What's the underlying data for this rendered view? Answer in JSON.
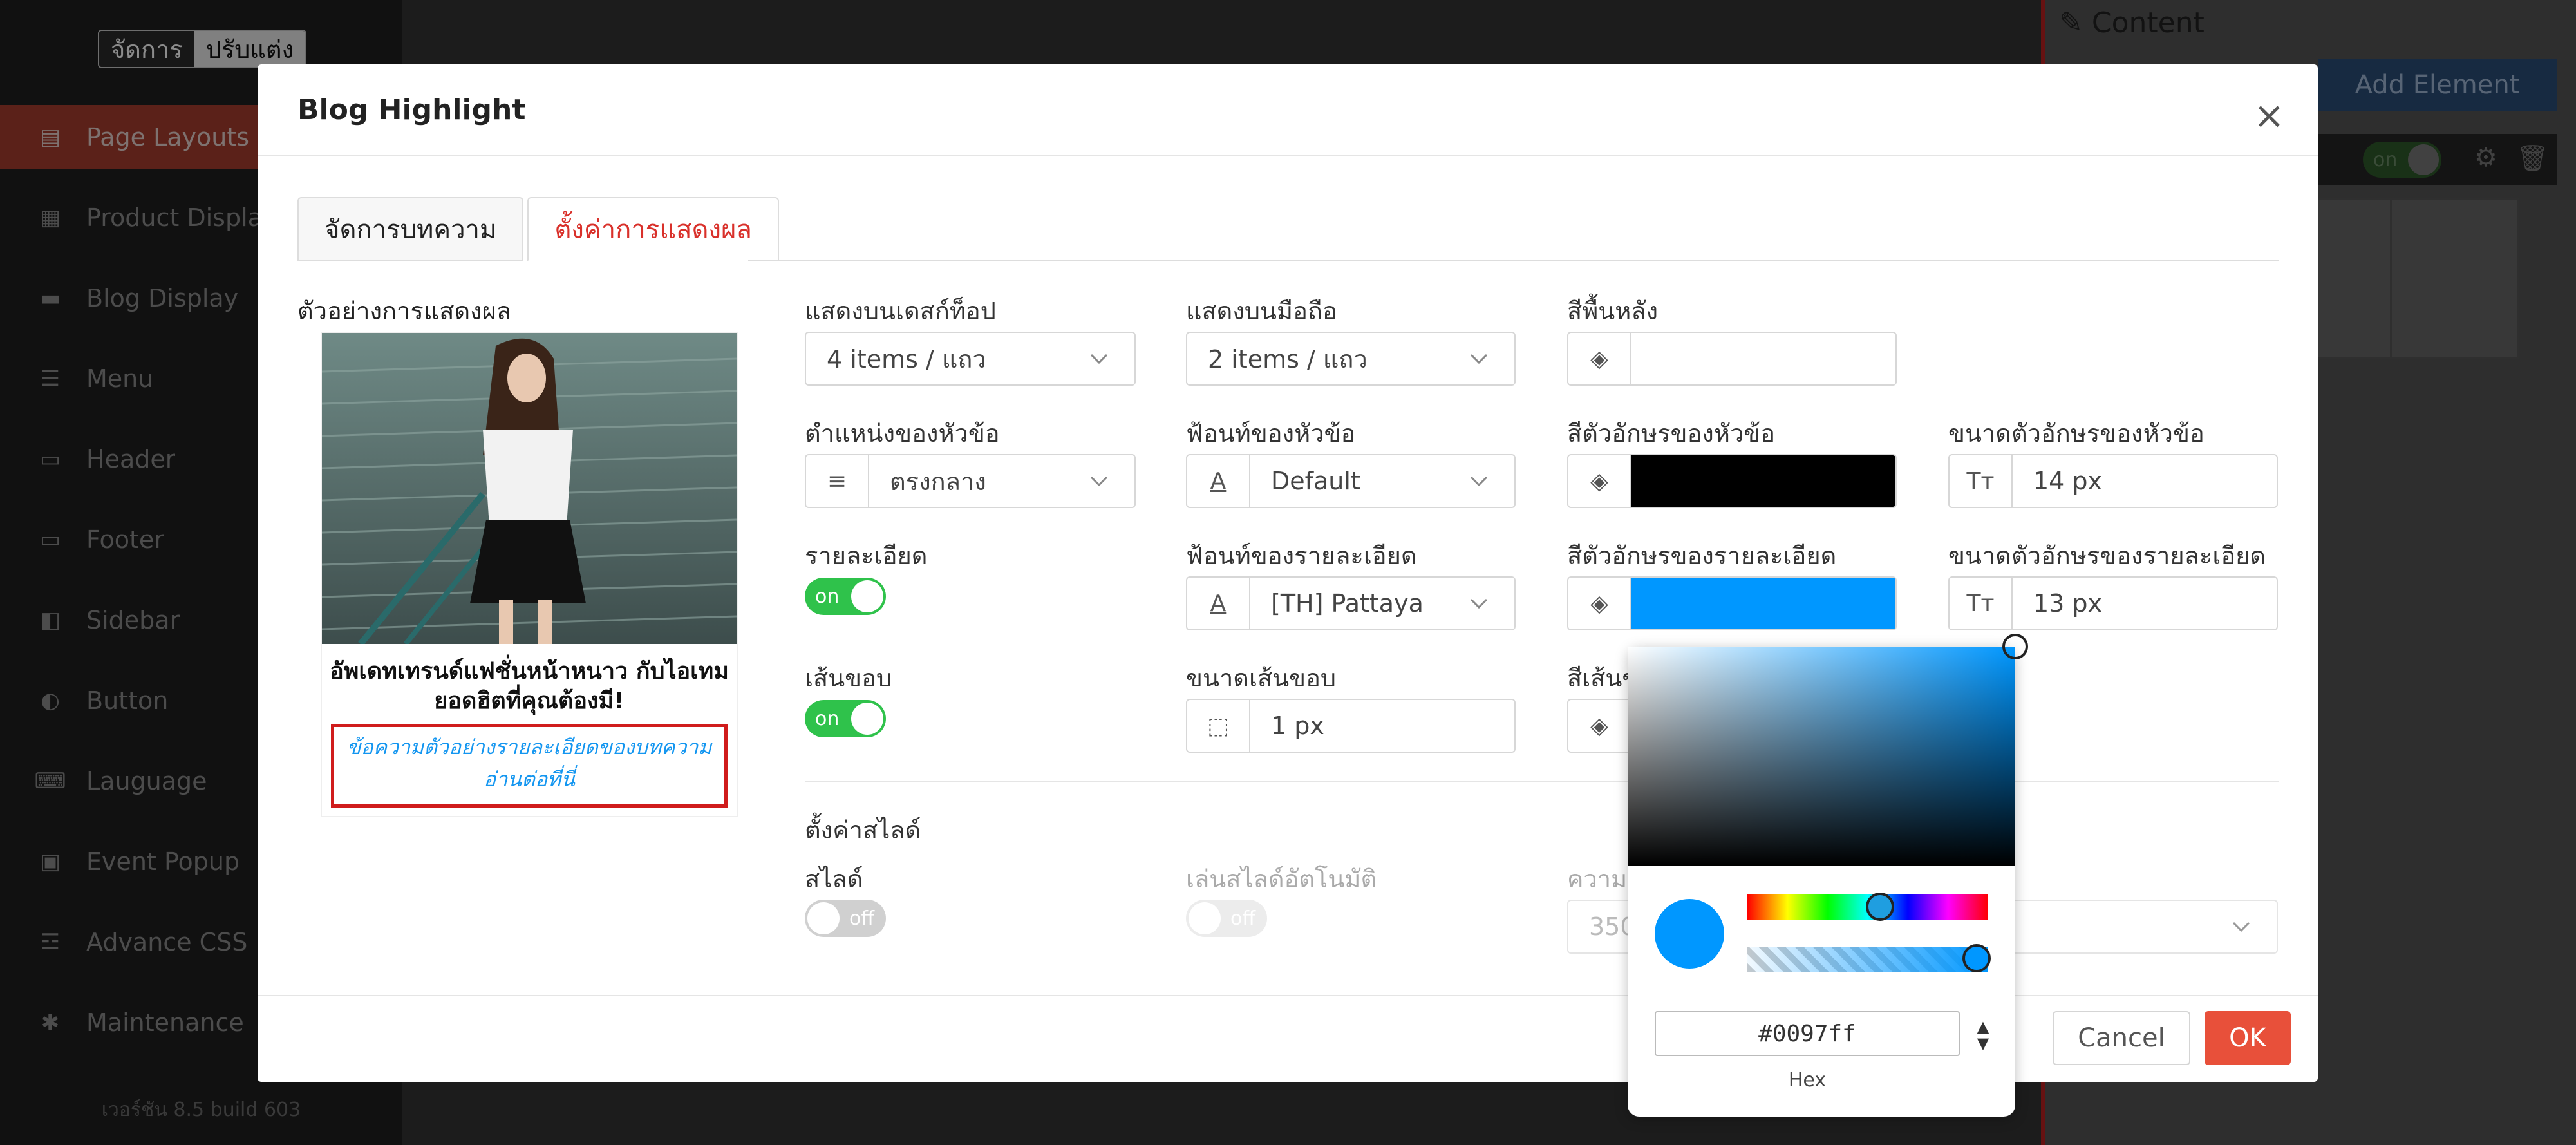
{
  "sidebar": {
    "switch": {
      "manage": "จัดการ",
      "customize": "ปรับแต่ง"
    },
    "items": [
      {
        "label": "Page Layouts",
        "icon": "layout-icon"
      },
      {
        "label": "Product Display",
        "icon": "grid-icon"
      },
      {
        "label": "Blog Display",
        "icon": "card-icon"
      },
      {
        "label": "Menu",
        "icon": "menu-icon"
      },
      {
        "label": "Header",
        "icon": "window-icon"
      },
      {
        "label": "Footer",
        "icon": "footer-icon"
      },
      {
        "label": "Sidebar",
        "icon": "sidebar-icon"
      },
      {
        "label": "Button",
        "icon": "toggle-icon"
      },
      {
        "label": "Lauguage",
        "icon": "language-icon"
      },
      {
        "label": "Event Popup",
        "icon": "ticket-icon"
      },
      {
        "label": "Advance CSS",
        "icon": "css-icon"
      },
      {
        "label": "Maintenance",
        "icon": "bug-icon"
      }
    ],
    "version": "เวอร์ชัน 8.5 build 603"
  },
  "right_panel": {
    "title": "Content",
    "add_element": "Add Element",
    "toggle_label": "on"
  },
  "modal": {
    "title": "Blog Highlight",
    "tabs": [
      "จัดการบทความ",
      "ตั้งค่าการแสดงผล"
    ],
    "active_tab": 1,
    "preview": {
      "label": "ตัวอย่างการแสดงผล",
      "title": "อัพเดทเทรนด์แฟชั่นหน้าหนาว กับไอเทมยอดฮิตที่คุณต้องมี!",
      "description": "ข้อความตัวอย่างรายละเอียดของบทความ อ่านต่อที่นี่"
    },
    "fields": {
      "desktop": {
        "label": "แสดงบนเดสก์ท็อป",
        "value": "4 items / แถว"
      },
      "mobile": {
        "label": "แสดงบนมือถือ",
        "value": "2 items / แถว"
      },
      "bg_color": {
        "label": "สีพื้นหลัง",
        "value": ""
      },
      "heading_pos": {
        "label": "ตำแหน่งของหัวข้อ",
        "value": "ตรงกลาง"
      },
      "heading_font": {
        "label": "ฟ้อนท์ของหัวข้อ",
        "value": "Default"
      },
      "heading_color": {
        "label": "สีตัวอักษรของหัวข้อ",
        "color": "#000000"
      },
      "heading_size": {
        "label": "ขนาดตัวอักษรของหัวข้อ",
        "value": "14 px"
      },
      "detail": {
        "label": "รายละเอียด",
        "toggle": "on"
      },
      "detail_font": {
        "label": "ฟ้อนท์ของรายละเอียด",
        "value": "[TH] Pattaya"
      },
      "detail_color": {
        "label": "สีตัวอักษรของรายละเอียด",
        "color": "#0097ff"
      },
      "detail_size": {
        "label": "ขนาดตัวอักษรของรายละเอียด",
        "value": "13 px"
      },
      "border": {
        "label": "เส้นขอบ",
        "toggle": "on"
      },
      "border_size": {
        "label": "ขนาดเส้นขอบ",
        "value": "1 px"
      },
      "border_color": {
        "label": "สีเส้นข"
      }
    },
    "slide": {
      "section_title": "ตั้งค่าสไลด์",
      "slide": {
        "label": "สไลด์",
        "toggle": "off"
      },
      "autoplay": {
        "label": "เล่นสไลด์อัตโนมัติ",
        "toggle": "off"
      },
      "speed": {
        "label": "ความเ",
        "value": "350"
      }
    },
    "buttons": {
      "cancel": "Cancel",
      "ok": "OK"
    }
  },
  "color_picker": {
    "hex": "#0097ff",
    "mode_label": "Hex",
    "color": "#0097ff",
    "hue_fraction": 0.55,
    "alpha_fraction": 1.0
  }
}
